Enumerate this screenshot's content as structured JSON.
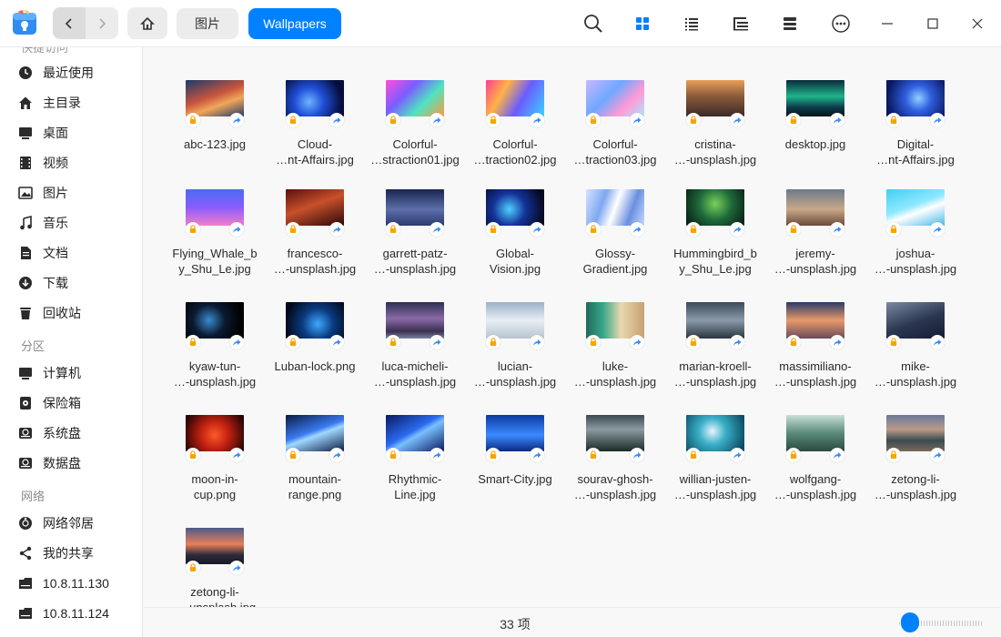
{
  "toolbar": {
    "crumb_pictures": "图片",
    "crumb_wallpapers": "Wallpapers",
    "icons": [
      "search-icon",
      "icon-view-icon",
      "list-view-icon",
      "tree-view-icon",
      "details-panel-icon",
      "more-icon",
      "minimize-icon",
      "maximize-icon",
      "close-icon"
    ]
  },
  "sidebar": {
    "section_quick_partial": "快捷访问",
    "section_partition": "分区",
    "section_network": "网络",
    "items": [
      {
        "label": "最近使用",
        "icon": "clock-icon"
      },
      {
        "label": "主目录",
        "icon": "home-icon"
      },
      {
        "label": "桌面",
        "icon": "desktop-icon"
      },
      {
        "label": "视频",
        "icon": "film-icon"
      },
      {
        "label": "图片",
        "icon": "image-icon"
      },
      {
        "label": "音乐",
        "icon": "music-icon"
      },
      {
        "label": "文档",
        "icon": "document-icon"
      },
      {
        "label": "下载",
        "icon": "download-icon"
      },
      {
        "label": "回收站",
        "icon": "trash-icon"
      },
      {
        "label": "计算机",
        "icon": "computer-icon"
      },
      {
        "label": "保险箱",
        "icon": "safe-icon"
      },
      {
        "label": "系统盘",
        "icon": "disk-icon"
      },
      {
        "label": "数据盘",
        "icon": "disk-icon"
      },
      {
        "label": "网络邻居",
        "icon": "network-icon"
      },
      {
        "label": "我的共享",
        "icon": "share-icon"
      },
      {
        "label": "10.8.11.130",
        "icon": "server-icon"
      },
      {
        "label": "10.8.11.124",
        "icon": "server-icon"
      }
    ]
  },
  "files": [
    {
      "name": "abc-123.jpg"
    },
    {
      "name": "Cloud-\n…nt-Affairs.jpg"
    },
    {
      "name": "Colorful-\n…straction01.jpg"
    },
    {
      "name": "Colorful-\n…traction02.jpg"
    },
    {
      "name": "Colorful-\n…traction03.jpg"
    },
    {
      "name": "cristina-\n…-unsplash.jpg"
    },
    {
      "name": "desktop.jpg"
    },
    {
      "name": "Digital-\n…nt-Affairs.jpg"
    },
    {
      "name": "Flying_Whale_b\ny_Shu_Le.jpg"
    },
    {
      "name": "francesco-\n…-unsplash.jpg"
    },
    {
      "name": "garrett-patz-\n…-unsplash.jpg"
    },
    {
      "name": "Global-\nVision.jpg"
    },
    {
      "name": "Glossy-\nGradient.jpg"
    },
    {
      "name": "Hummingbird_b\ny_Shu_Le.jpg"
    },
    {
      "name": "jeremy-\n…-unsplash.jpg"
    },
    {
      "name": "joshua-\n…-unsplash.jpg"
    },
    {
      "name": "kyaw-tun-\n…-unsplash.jpg"
    },
    {
      "name": "Luban-lock.png"
    },
    {
      "name": "luca-micheli-\n…-unsplash.jpg"
    },
    {
      "name": "lucian-\n…-unsplash.jpg"
    },
    {
      "name": "luke-\n…-unsplash.jpg"
    },
    {
      "name": "marian-kroell-\n…-unsplash.jpg"
    },
    {
      "name": "massimiliano-\n…-unsplash.jpg"
    },
    {
      "name": "mike-\n…-unsplash.jpg"
    },
    {
      "name": "moon-in-\ncup.png"
    },
    {
      "name": "mountain-\nrange.png"
    },
    {
      "name": "Rhythmic-\nLine.jpg"
    },
    {
      "name": "Smart-City.jpg"
    },
    {
      "name": "sourav-ghosh-\n…-unsplash.jpg"
    },
    {
      "name": "willian-justen-\n…-unsplash.jpg"
    },
    {
      "name": "wolfgang-\n…-unsplash.jpg"
    },
    {
      "name": "zetong-li-\n…-unsplash.jpg"
    },
    {
      "name": "zetong-li-\n…-unsplash.jpg"
    }
  ],
  "status": {
    "count_text": "33 项"
  },
  "colors": {
    "accent": "#0081ff",
    "lock_emblem": "#f7a400",
    "share_emblem": "#3a8cf5"
  }
}
